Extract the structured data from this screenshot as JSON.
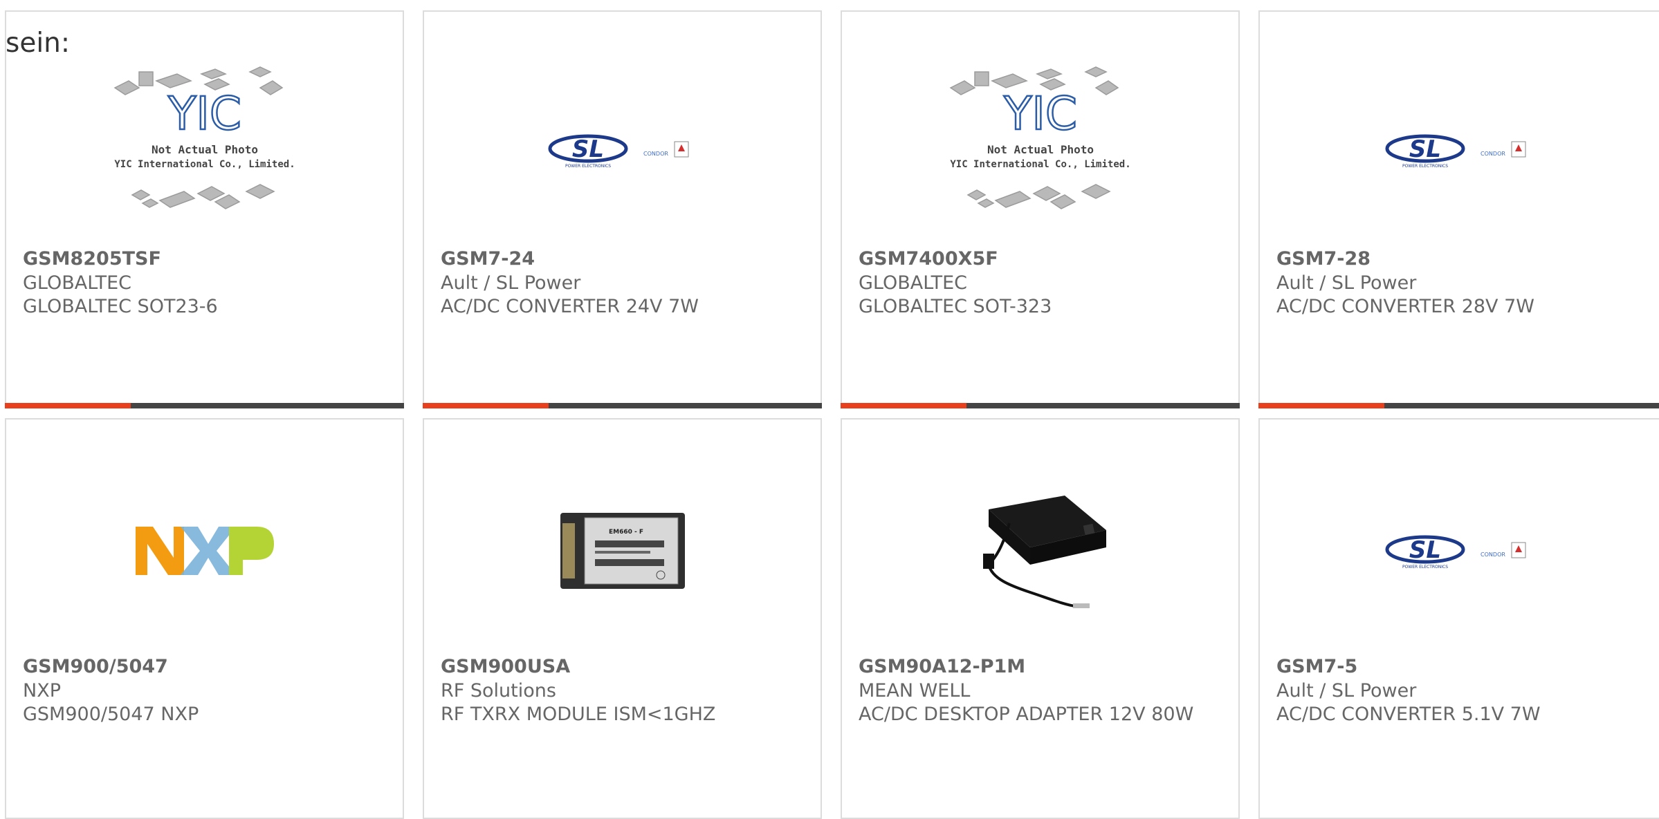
{
  "lead_text": "sein:",
  "placeholder_text": {
    "line1": "Not Actual Photo",
    "line2": "YIC International Co., Limited.",
    "logo": "YIC"
  },
  "brand_logos": {
    "sl": "SL",
    "sl_sub": "POWER ELECTRONICS",
    "condor": "CONDOR",
    "nxp": "NXP",
    "module_label": "EM660 - F"
  },
  "colors": {
    "accent_bar": "#e8401c",
    "bar_dark": "#444444",
    "card_border": "#dcdcdc",
    "sl_blue": "#1d3a8a",
    "nxp_orange": "#f39c12",
    "nxp_blue": "#7ab2d8",
    "nxp_green": "#b4d334"
  },
  "products": [
    {
      "part": "GSM8205TSF",
      "manufacturer": "GLOBALTEC",
      "description": "GLOBALTEC SOT23-6",
      "image": "yic-placeholder-icon"
    },
    {
      "part": "GSM7-24",
      "manufacturer": "Ault / SL Power",
      "description": "AC/DC CONVERTER 24V 7W",
      "image": "sl-power-logo-icon"
    },
    {
      "part": "GSM7400X5F",
      "manufacturer": "GLOBALTEC",
      "description": "GLOBALTEC SOT-323",
      "image": "yic-placeholder-icon"
    },
    {
      "part": "GSM7-28",
      "manufacturer": "Ault / SL Power",
      "description": "AC/DC CONVERTER 28V 7W",
      "image": "sl-power-logo-icon"
    },
    {
      "part": "GSM900/5047",
      "manufacturer": "NXP",
      "description": "GSM900/5047 NXP",
      "image": "nxp-logo-icon"
    },
    {
      "part": "GSM900USA",
      "manufacturer": "RF Solutions",
      "description": "RF TXRX MODULE ISM<1GHZ",
      "image": "rf-module-icon"
    },
    {
      "part": "GSM90A12-P1M",
      "manufacturer": "MEAN WELL",
      "description": "AC/DC DESKTOP ADAPTER 12V 80W",
      "image": "power-adapter-icon"
    },
    {
      "part": "GSM7-5",
      "manufacturer": "Ault / SL Power",
      "description": "AC/DC CONVERTER 5.1V 7W",
      "image": "sl-power-logo-icon"
    }
  ]
}
